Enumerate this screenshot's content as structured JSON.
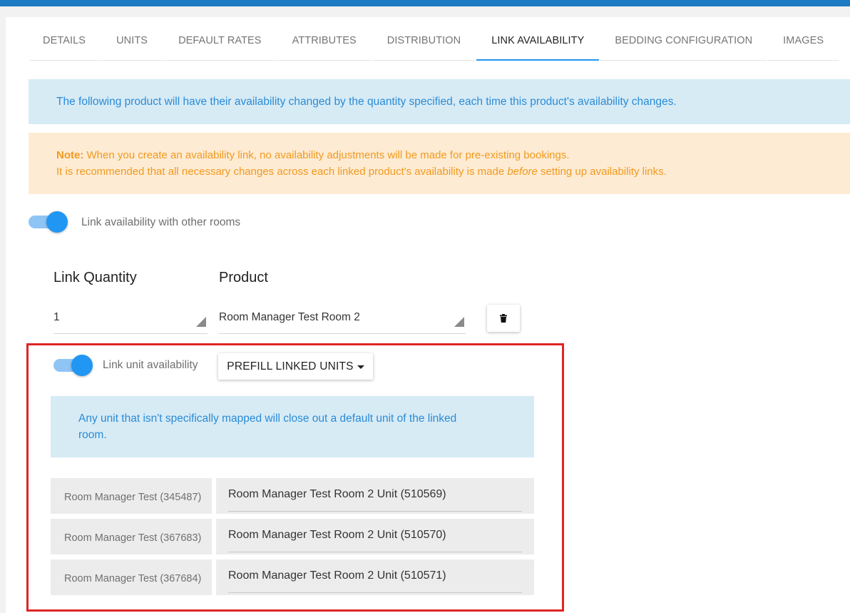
{
  "tabs": [
    {
      "label": "DETAILS"
    },
    {
      "label": "UNITS"
    },
    {
      "label": "DEFAULT RATES"
    },
    {
      "label": "ATTRIBUTES"
    },
    {
      "label": "DISTRIBUTION"
    },
    {
      "label": "LINK AVAILABILITY",
      "active": true
    },
    {
      "label": "BEDDING CONFIGURATION"
    },
    {
      "label": "IMAGES"
    }
  ],
  "info_banner": "The following product will have their availability changed by the quantity specified, each time this product's availability changes.",
  "note": {
    "label": "Note:",
    "line1": "When you create an availability link, no availability adjustments will be made for pre-existing bookings.",
    "line2_pre": "It is recommended that all necessary changes across each linked product's availability is made ",
    "line2_em": "before",
    "line2_post": " setting up availability links."
  },
  "link_toggle": {
    "label": "Link availability with other rooms",
    "on": true
  },
  "columns": {
    "quantity": "Link Quantity",
    "product": "Product"
  },
  "link_row": {
    "quantity": "1",
    "product": "Room Manager Test Room 2"
  },
  "unit_toggle": {
    "label": "Link unit availability",
    "on": true
  },
  "prefill_button": "PREFILL LINKED UNITS",
  "unit_info": "Any unit that isn't specifically mapped will close out a default unit of the linked room.",
  "unit_mappings": [
    {
      "source": "Room Manager Test (345487)",
      "target": "Room Manager Test Room 2 Unit (510569)"
    },
    {
      "source": "Room Manager Test (367683)",
      "target": "Room Manager Test Room 2 Unit (510570)"
    },
    {
      "source": "Room Manager Test (367684)",
      "target": "Room Manager Test Room 2 Unit (510571)"
    }
  ],
  "colors": {
    "accent": "#2196f3",
    "info_text": "#2a8bd6",
    "warning_text": "#f09a1f",
    "highlight_border": "#e02424"
  }
}
